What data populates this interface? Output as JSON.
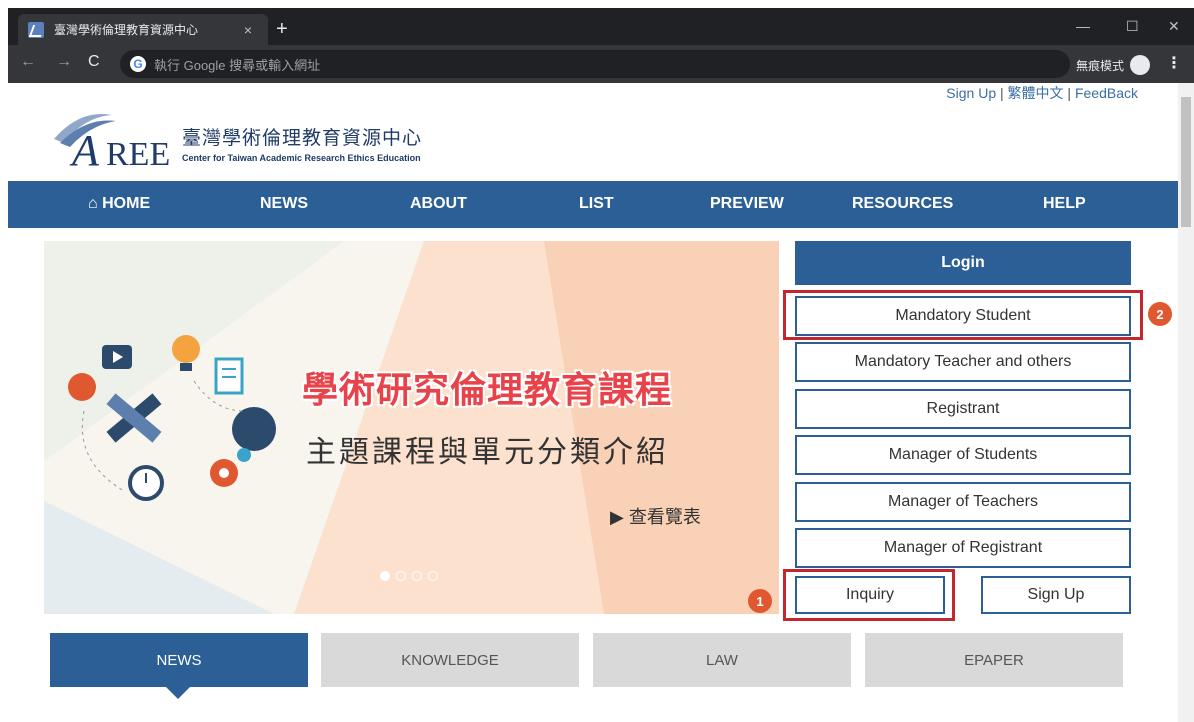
{
  "browser": {
    "tab_title": "臺灣學術倫理教育資源中心",
    "tab_close": "×",
    "new_tab": "+",
    "omnibox_placeholder": "執行 Google 搜尋或輸入網址",
    "incognito_label": "無痕模式",
    "window_minimize": "—",
    "window_maximize": "☐",
    "window_close": "✕"
  },
  "top_links": {
    "sign_up": "Sign Up",
    "sep1": " | ",
    "chinese": "繁體中文",
    "sep2": " | ",
    "feedback": "FeedBack"
  },
  "logo": {
    "mark": "AREE",
    "name_zh": "臺灣學術倫理教育資源中心",
    "name_en": "Center for Taiwan Academic Research Ethics Education"
  },
  "main_nav": {
    "items": [
      {
        "label": "HOME",
        "icon": "home-icon"
      },
      {
        "label": "NEWS"
      },
      {
        "label": "ABOUT"
      },
      {
        "label": "LIST"
      },
      {
        "label": "PREVIEW"
      },
      {
        "label": "RESOURCES"
      },
      {
        "label": "HELP"
      }
    ]
  },
  "banner": {
    "title": "學術研究倫理教育課程",
    "subtitle": "主題課程與單元分類介紹",
    "link": "▶ 查看覽表"
  },
  "login": {
    "header": "Login",
    "roles": [
      "Mandatory Student",
      "Mandatory Teacher and others",
      "Registrant",
      "Manager of Students",
      "Manager of Teachers",
      "Manager of Registrant"
    ],
    "inquiry": "Inquiry",
    "sign_up": "Sign Up"
  },
  "annotations": {
    "marker_1": "1",
    "marker_2": "2",
    "highlight_color": "#c4262e",
    "marker_color": "#e0582f"
  },
  "content_tabs": [
    {
      "label": "NEWS",
      "active": true
    },
    {
      "label": "KNOWLEDGE",
      "active": false
    },
    {
      "label": "LAW",
      "active": false
    },
    {
      "label": "EPAPER",
      "active": false
    }
  ],
  "colors": {
    "brand_blue": "#2b5f95",
    "link_blue": "#3b6ea5"
  }
}
